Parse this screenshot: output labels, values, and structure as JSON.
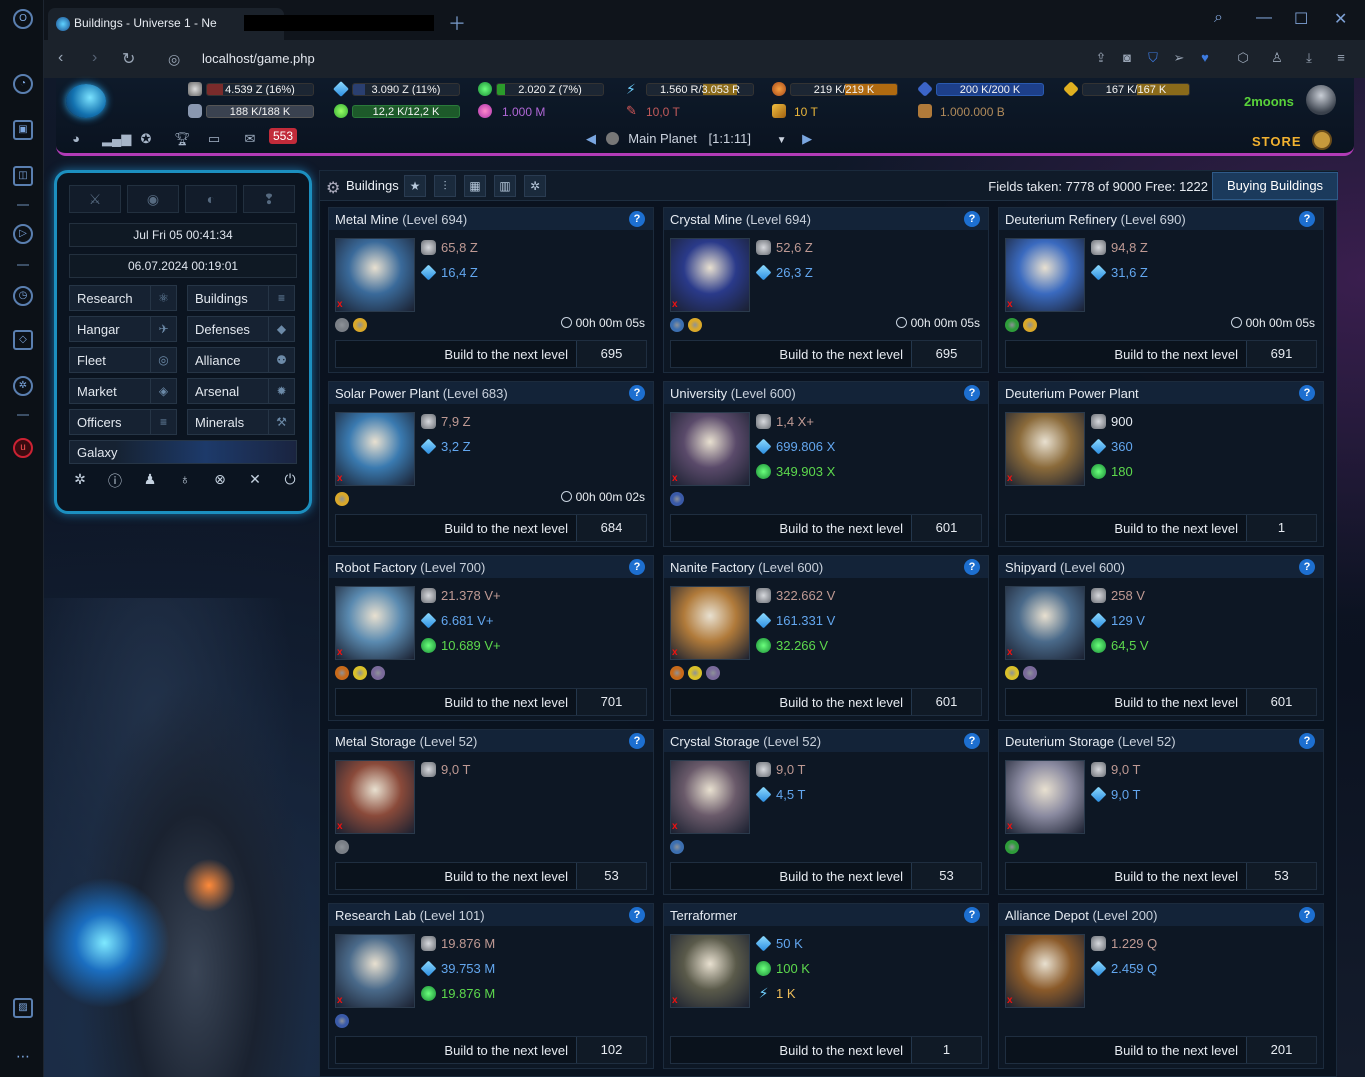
{
  "browser": {
    "tab_title": "Buildings - Universe 1 - Ne",
    "url": "localhost/game.php"
  },
  "header": {
    "resources": [
      {
        "value": "4.539 Z (16%)",
        "sub": "188 K/188 K",
        "color": "#7a2b2b"
      },
      {
        "value": "3.090 Z (11%)",
        "sub": "12,2 K/12,2 K",
        "color": "#2a3f70"
      },
      {
        "value": "2.020 Z (7%)",
        "sub": "1.000 M",
        "color": "#2b6b2b"
      },
      {
        "value": "1.560 R/3.053 R",
        "sub": "10,0 T",
        "color": "#8a6a1a"
      },
      {
        "value": "219 K/219 K",
        "sub": "10 T",
        "color": "#b06a10"
      },
      {
        "value": "200 K/200 K",
        "sub": "1.000.000 B",
        "color": "#1d3f8a"
      },
      {
        "value": "167 K/167 K",
        "sub": "",
        "color": "#8a6a1a"
      }
    ],
    "nickname": "2moons",
    "store_label": "STORE",
    "messages_count": "553",
    "planet_name": "Main Planet",
    "planet_coords": "[1:1:11]"
  },
  "menu": {
    "server_time": "Jul Fri 05 00:41:34",
    "datetime": "06.07.2024 00:19:01",
    "items": [
      {
        "label": "Research",
        "icon": "⚛"
      },
      {
        "label": "Buildings",
        "icon": "≡"
      },
      {
        "label": "Hangar",
        "icon": "✈"
      },
      {
        "label": "Defenses",
        "icon": "◆"
      },
      {
        "label": "Fleet",
        "icon": "◎"
      },
      {
        "label": "Alliance",
        "icon": "⚉"
      },
      {
        "label": "Market",
        "icon": "◈"
      },
      {
        "label": "Arsenal",
        "icon": "✹"
      },
      {
        "label": "Officers",
        "icon": "≡"
      },
      {
        "label": "Minerals",
        "icon": "⚒"
      }
    ],
    "galaxy_label": "Galaxy"
  },
  "main": {
    "title": "Buildings",
    "fields_text": "Fields taken: 7778 of 9000 Free: 1222",
    "buying_label": "Buying Buildings",
    "build_label": "Build to the next level",
    "buildings": [
      {
        "name": "Metal Mine",
        "level": "(Level 694)",
        "costs": [
          [
            "m",
            "65,8 Z"
          ],
          [
            "c",
            "16,4 Z"
          ]
        ],
        "req": [
          "#7a7f86",
          "#d9a82a"
        ],
        "time": "00h 00m 05s",
        "next": "695",
        "img": "#3a6a9a"
      },
      {
        "name": "Crystal Mine",
        "level": "(Level 694)",
        "costs": [
          [
            "m",
            "52,6 Z"
          ],
          [
            "c",
            "26,3 Z"
          ]
        ],
        "req": [
          "#3c6fb0",
          "#d9a82a"
        ],
        "time": "00h 00m 05s",
        "next": "695",
        "img": "#2a3a8a"
      },
      {
        "name": "Deuterium Refinery",
        "level": "(Level 690)",
        "costs": [
          [
            "m",
            "94,8 Z"
          ],
          [
            "c",
            "31,6 Z"
          ]
        ],
        "req": [
          "#2e9c3a",
          "#d9a82a"
        ],
        "time": "00h 00m 05s",
        "next": "691",
        "img": "#3a6abf"
      },
      {
        "name": "Solar Power Plant",
        "level": "(Level 683)",
        "costs": [
          [
            "m",
            "7,9 Z"
          ],
          [
            "c",
            "3,2 Z"
          ]
        ],
        "req": [
          "#d9a82a"
        ],
        "time": "00h 00m 02s",
        "next": "684",
        "img": "#3a7ab0"
      },
      {
        "name": "University",
        "level": "(Level 600)",
        "costs": [
          [
            "m",
            "1,4 X+"
          ],
          [
            "c",
            "699.806 X"
          ],
          [
            "d",
            "349.903 X"
          ]
        ],
        "req": [
          "#3a5aa8"
        ],
        "time": "",
        "next": "601",
        "img": "#5a4a6a"
      },
      {
        "name": "Deuterium Power Plant",
        "level": "",
        "costs": [
          [
            "mw",
            "900"
          ],
          [
            "cw",
            "360"
          ],
          [
            "dw",
            "180"
          ]
        ],
        "req": [],
        "time": "",
        "next": "1",
        "img": "#8a6a3a"
      },
      {
        "name": "Robot Factory",
        "level": "(Level 700)",
        "costs": [
          [
            "m",
            "21.378 V+"
          ],
          [
            "c",
            "6.681 V+"
          ],
          [
            "d",
            "10.689 V+"
          ]
        ],
        "req": [
          "#c86a1a",
          "#d9c02a",
          "#7a6a9a"
        ],
        "time": "",
        "next": "701",
        "img": "#5a8ab0"
      },
      {
        "name": "Nanite Factory",
        "level": "(Level 600)",
        "costs": [
          [
            "m",
            "322.662 V"
          ],
          [
            "c",
            "161.331 V"
          ],
          [
            "d",
            "32.266 V"
          ]
        ],
        "req": [
          "#c86a1a",
          "#d9c02a",
          "#7a6a9a"
        ],
        "time": "",
        "next": "601",
        "img": "#b07a3a"
      },
      {
        "name": "Shipyard",
        "level": "(Level 600)",
        "costs": [
          [
            "m",
            "258 V"
          ],
          [
            "c",
            "129 V"
          ],
          [
            "d",
            "64,5 V"
          ]
        ],
        "req": [
          "#d9c02a",
          "#7a6a9a"
        ],
        "time": "",
        "next": "601",
        "img": "#4a6a8a"
      },
      {
        "name": "Metal Storage",
        "level": "(Level 52)",
        "costs": [
          [
            "m",
            "9,0 T"
          ]
        ],
        "req": [
          "#7a7f86"
        ],
        "time": "",
        "next": "53",
        "img": "#8a4a3a"
      },
      {
        "name": "Crystal Storage",
        "level": "(Level 52)",
        "costs": [
          [
            "m",
            "9,0 T"
          ],
          [
            "c",
            "4,5 T"
          ]
        ],
        "req": [
          "#3c6fb0"
        ],
        "time": "",
        "next": "53",
        "img": "#6a5a6a"
      },
      {
        "name": "Deuterium Storage",
        "level": "(Level 52)",
        "costs": [
          [
            "m",
            "9,0 T"
          ],
          [
            "c",
            "9,0 T"
          ]
        ],
        "req": [
          "#2e9c3a"
        ],
        "time": "",
        "next": "53",
        "img": "#8a8aa0"
      },
      {
        "name": "Research Lab",
        "level": "(Level 101)",
        "costs": [
          [
            "m",
            "19.876 M"
          ],
          [
            "c",
            "39.753 M"
          ],
          [
            "d",
            "19.876 M"
          ]
        ],
        "req": [
          "#3a5aa8"
        ],
        "time": "",
        "next": "102",
        "img": "#4a6a8a"
      },
      {
        "name": "Terraformer",
        "level": "",
        "costs": [
          [
            "c",
            "50 K"
          ],
          [
            "d",
            "100 K"
          ],
          [
            "e",
            "1 K"
          ]
        ],
        "req": [],
        "time": "",
        "next": "1",
        "img": "#5a5a4a"
      },
      {
        "name": "Alliance Depot",
        "level": "(Level 200)",
        "costs": [
          [
            "m",
            "1.229 Q"
          ],
          [
            "c",
            "2.459 Q"
          ]
        ],
        "req": [],
        "time": "",
        "next": "201",
        "img": "#8a5a2a"
      }
    ]
  }
}
